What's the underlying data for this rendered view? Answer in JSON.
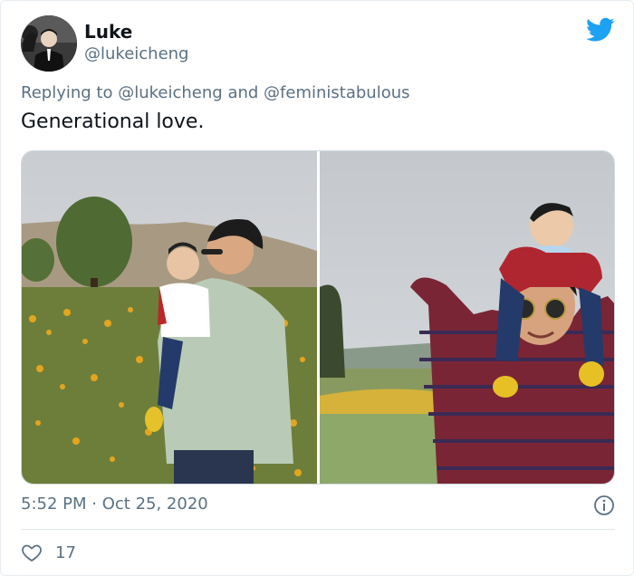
{
  "tweet": {
    "author_name": "Luke",
    "author_handle": "@lukeicheng",
    "replying_prefix": "Replying to",
    "reply_mentions": [
      "@lukeicheng",
      "@feministabulous"
    ],
    "reply_joiner": "and",
    "text": "Generational love.",
    "time": "5:52 PM",
    "separator": "·",
    "date": "Oct 25, 2020",
    "like_count": "17"
  },
  "icons": {
    "brand": "twitter-bird-icon",
    "info": "info-icon",
    "like": "heart-icon"
  },
  "colors": {
    "brand": "#1da1f2",
    "text_primary": "#0f1419",
    "text_secondary": "#5b7083",
    "divider": "#e1e8ed"
  }
}
